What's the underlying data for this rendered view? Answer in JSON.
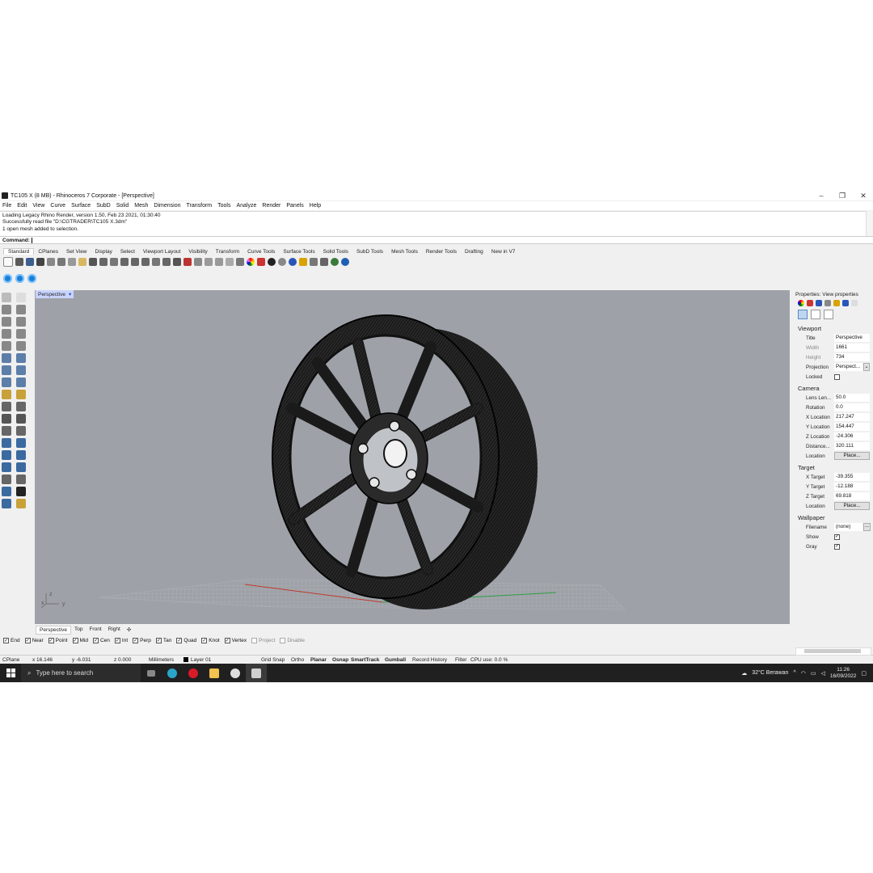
{
  "window": {
    "title": "TC105 X (8 MB) - Rhinoceros 7 Corporate - [Perspective]",
    "controls": [
      "–",
      "❐",
      "✕"
    ]
  },
  "menu": [
    "File",
    "Edit",
    "View",
    "Curve",
    "Surface",
    "SubD",
    "Solid",
    "Mesh",
    "Dimension",
    "Transform",
    "Tools",
    "Analyze",
    "Render",
    "Panels",
    "Help"
  ],
  "command_history": [
    "Loading Legacy Rhino Render, version 1.50, Feb 23 2021, 01:30:40",
    "Successfully read file \"D:\\CGTRADER\\TC105 X.3dm\"",
    "1 open mesh added to selection."
  ],
  "command_prompt": "Command:",
  "toolbar_tabs": [
    "Standard",
    "CPlanes",
    "Set View",
    "Display",
    "Select",
    "Viewport Layout",
    "Visibility",
    "Transform",
    "Curve Tools",
    "Surface Tools",
    "Solid Tools",
    "SubD Tools",
    "Mesh Tools",
    "Render Tools",
    "Drafting",
    "New in V7"
  ],
  "viewport": {
    "label": "Perspective",
    "dropdown": "▾",
    "axis_z": "z",
    "axis_x": "x",
    "axis_y": "y"
  },
  "view_tabs": [
    "Perspective",
    "Top",
    "Front",
    "Right",
    "✣"
  ],
  "osnaps": [
    {
      "label": "End",
      "checked": true
    },
    {
      "label": "Near",
      "checked": true
    },
    {
      "label": "Point",
      "checked": true
    },
    {
      "label": "Mid",
      "checked": true
    },
    {
      "label": "Cen",
      "checked": true
    },
    {
      "label": "Int",
      "checked": true
    },
    {
      "label": "Perp",
      "checked": true
    },
    {
      "label": "Tan",
      "checked": true
    },
    {
      "label": "Quad",
      "checked": true
    },
    {
      "label": "Knot",
      "checked": true
    },
    {
      "label": "Vertex",
      "checked": true
    },
    {
      "label": "Project",
      "checked": false
    },
    {
      "label": "Disable",
      "checked": false
    }
  ],
  "status": {
    "cplane": "CPlane",
    "x": "x 16.146",
    "y": "y -6.031",
    "z": "z 0.000",
    "units": "Millimeters",
    "layer": "Layer 01",
    "grid_snap": "Grid Snap",
    "ortho": "Ortho",
    "planar": "Planar",
    "osnap": "Osnap",
    "smarttrack": "SmartTrack",
    "gumball": "Gumball",
    "record_history": "Record History",
    "filter": "Filter",
    "cpu": "CPU use: 0.0 %"
  },
  "properties": {
    "header": "Properties: View properties",
    "viewport_section": "Viewport",
    "title_label": "Title",
    "title_value": "Perspective",
    "width_label": "Width",
    "width_value": "1661",
    "height_label": "Height",
    "height_value": "734",
    "projection_label": "Projection",
    "projection_value": "Perspect...",
    "locked_label": "Locked",
    "camera_section": "Camera",
    "lens_label": "Lens Len...",
    "lens_value": "50.0",
    "rotation_label": "Rotation",
    "rotation_value": "0.0",
    "xloc_label": "X Location",
    "xloc_value": "217.247",
    "yloc_label": "Y Location",
    "yloc_value": "154.447",
    "zloc_label": "Z Location",
    "zloc_value": "-24.306",
    "distance_label": "Distance...",
    "distance_value": "320.111",
    "location_label": "Location",
    "place_button": "Place...",
    "target_section": "Target",
    "xt_label": "X Target",
    "xt_value": "-39.355",
    "yt_label": "Y Target",
    "yt_value": "-12.188",
    "zt_label": "Z Target",
    "zt_value": "69.818",
    "tloc_label": "Location",
    "tplace_button": "Place...",
    "wallpaper_section": "Wallpaper",
    "filename_label": "Filename",
    "filename_value": "(none)",
    "browse": "...",
    "show_label": "Show",
    "gray_label": "Gray"
  },
  "taskbar": {
    "search_placeholder": "Type here to search",
    "weather": "32°C  Berawan",
    "time": "11:26",
    "date": "16/09/2022"
  },
  "colors": {
    "viewport_bg": "#9ea2a8",
    "viewport_label_bg": "#c9d4ff",
    "taskbar_bg": "#202020",
    "x_axis": "#c0392b",
    "y_axis": "#2e9e44"
  }
}
